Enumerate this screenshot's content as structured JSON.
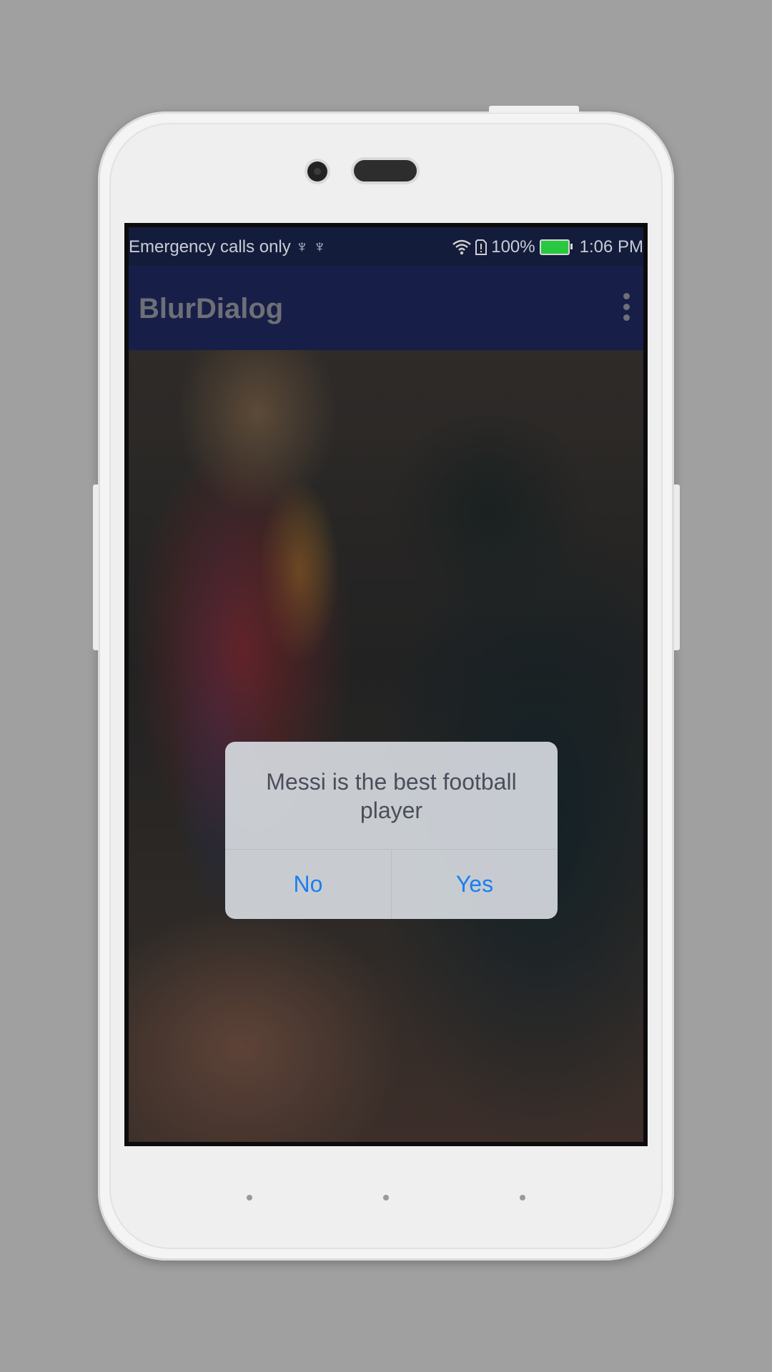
{
  "status_bar": {
    "carrier_text": "Emergency calls only",
    "usb_icons": "♆ ♆",
    "battery_percent": "100%",
    "time": "1:06 PM"
  },
  "app_bar": {
    "title": "BlurDialog"
  },
  "dialog": {
    "message": "Messi is the best football player",
    "negative_label": "No",
    "positive_label": "Yes"
  },
  "colors": {
    "status_bar_bg": "#141c3b",
    "app_bar_bg": "#171f48",
    "dialog_button_text": "#1a7ff0",
    "battery_fill": "#28c840"
  }
}
